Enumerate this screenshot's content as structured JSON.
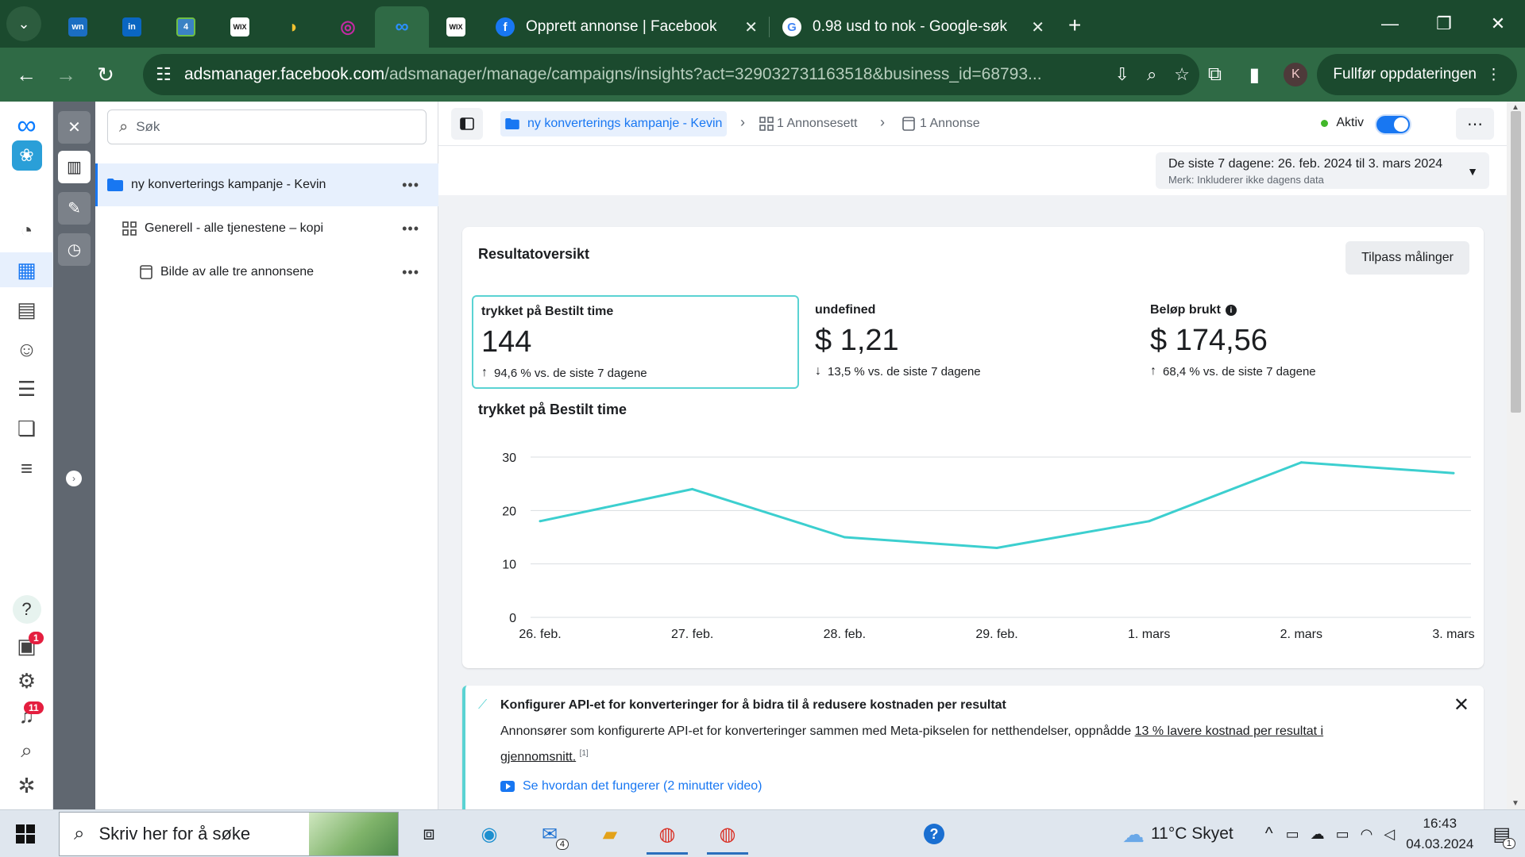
{
  "browser": {
    "pinned_tabs": [
      {
        "icon": "wn",
        "color": "#1b6ec2"
      },
      {
        "icon": "in",
        "color": "#0a66c2"
      },
      {
        "icon": "4",
        "color": "#3b82c4"
      },
      {
        "icon": "WIX",
        "color": "#111111"
      },
      {
        "icon": "banana-icon",
        "color": "#f2c230"
      },
      {
        "icon": "target-icon",
        "color": "#c32aa3"
      },
      {
        "icon": "meta-icon",
        "color": "#0a7cff"
      },
      {
        "icon": "WIX",
        "color": "#111111"
      }
    ],
    "tabs": [
      {
        "title": "Opprett annonse | Facebook",
        "icon": "facebook-icon"
      },
      {
        "title": "0.98 usd to nok - Google-søk",
        "icon": "google-icon"
      }
    ],
    "url_host": "adsmanager.facebook.com",
    "url_path": "/adsmanager/manage/campaigns/insights?act=329032731163518&business_id=68793...",
    "profile_initial": "K",
    "update_button": "Fullfør oppdateringen"
  },
  "rail": {
    "notifications_badge": "1",
    "alerts_badge": "11"
  },
  "tree": {
    "search_placeholder": "Søk",
    "rows": [
      {
        "label": "ny konverterings kampanje - Kevin"
      },
      {
        "label": "Generell - alle tjenestene – kopi"
      },
      {
        "label": "Bilde av alle tre annonsene"
      }
    ]
  },
  "breadcrumb": {
    "campaign": "ny konverterings kampanje - Kevin",
    "adsets": "1 Annonsesett",
    "ads": "1 Annonse",
    "status": "Aktiv"
  },
  "date_range": {
    "label": "De siste 7 dagene: 26. feb. 2024 til 3. mars 2024",
    "note": "Merk: Inkluderer ikke dagens data"
  },
  "overview": {
    "title": "Resultatoversikt",
    "customize_button": "Tilpass målinger",
    "metrics": [
      {
        "title": "trykket på Bestilt time",
        "value": "144",
        "change": "94,6 % vs. de siste 7 dagene",
        "direction": "up"
      },
      {
        "title": "undefined",
        "value": "$ 1,21",
        "change": "13,5 % vs. de siste 7 dagene",
        "direction": "down"
      },
      {
        "title": "Beløp brukt",
        "value": "$ 174,56",
        "change": "68,4 % vs. de siste 7 dagene",
        "direction": "up"
      }
    ]
  },
  "chart_data": {
    "type": "line",
    "title": "trykket på Bestilt time",
    "categories": [
      "26. feb.",
      "27. feb.",
      "28. feb.",
      "29. feb.",
      "1. mars",
      "2. mars",
      "3. mars"
    ],
    "values": [
      18,
      24,
      15,
      13,
      18,
      29,
      27
    ],
    "ylim": [
      0,
      30
    ],
    "yticks": [
      0,
      10,
      20,
      30
    ],
    "grid": true,
    "color": "#3ccfcf"
  },
  "api_banner": {
    "title": "Konfigurer API-et for konverteringer for å bidra til å redusere kostnaden per resultat",
    "body_start": "Annonsører som konfigurerte API-et for konverteringer sammen med Meta-pikselen for netthendelser, oppnådde ",
    "body_link": "13 % lavere kostnad per resultat i gjennomsnitt.",
    "footnote": "[1]",
    "video_link": "Se hvordan det fungerer (2 minutter video)"
  },
  "taskbar": {
    "search_text": "Skriv her for å søke",
    "mail_badge": "4",
    "weather": "11°C  Skyet",
    "time": "16:43",
    "date": "04.03.2024",
    "notif_badge": "1"
  }
}
